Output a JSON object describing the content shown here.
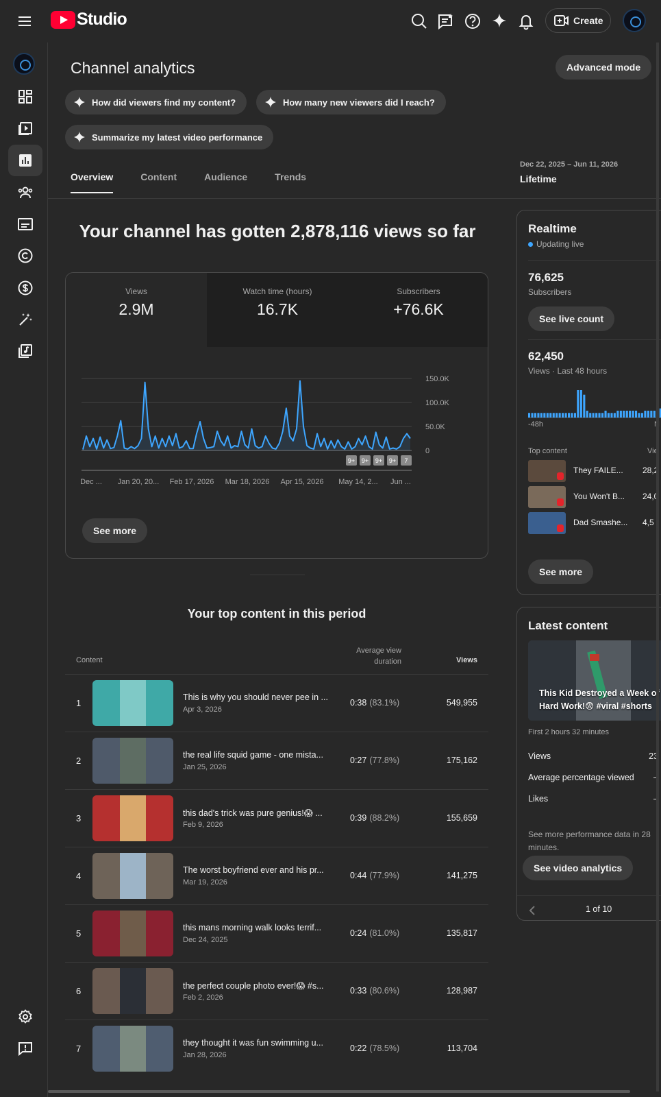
{
  "header": {
    "app_name": "Studio",
    "create_label": "Create"
  },
  "sidebar": {
    "items": [
      "dashboard-icon",
      "content-icon",
      "analytics-icon",
      "community-icon",
      "subtitles-icon",
      "copyright-icon",
      "earn-icon",
      "customization-icon",
      "audio-library-icon"
    ],
    "bottom": [
      "settings-icon",
      "feedback-icon"
    ]
  },
  "page": {
    "title": "Channel analytics",
    "advanced_mode_label": "Advanced mode",
    "chips": [
      "How did viewers find my content?",
      "How many new viewers did I reach?",
      "Summarize my latest video performance"
    ],
    "tabs": [
      "Overview",
      "Content",
      "Audience",
      "Trends"
    ],
    "active_tab": "Overview",
    "date_range": "Dec 22, 2025 – Jun 11, 2026",
    "date_label": "Lifetime",
    "headline": "Your channel has gotten 2,878,116 views so far"
  },
  "overview": {
    "metrics": [
      {
        "label": "Views",
        "value": "2.9M"
      },
      {
        "label": "Watch time (hours)",
        "value": "16.7K"
      },
      {
        "label": "Subscribers",
        "value": "+76.6K"
      }
    ],
    "see_more_label": "See more",
    "markers": [
      "9+",
      "9+",
      "9+",
      "9+",
      "7"
    ]
  },
  "chart_data": {
    "type": "line",
    "y_ticks": [
      "150.0K",
      "100.0K",
      "50.0K",
      "0"
    ],
    "ylim": [
      0,
      150000
    ],
    "x_tick_labels": [
      "Dec ...",
      "Jan 20, 20...",
      "Feb 17, 2026",
      "Mar 18, 2026",
      "Apr 15, 2026",
      "May 14, 2...",
      "Jun ..."
    ],
    "series": [
      {
        "color": "#3ea6ff",
        "values": [
          2000,
          30000,
          8000,
          25000,
          3000,
          28000,
          5000,
          22000,
          4000,
          6000,
          30000,
          62000,
          5000,
          3000,
          8000,
          4000,
          10000,
          25000,
          142000,
          45000,
          8000,
          30000,
          5000,
          25000,
          8000,
          30000,
          10000,
          35000,
          5000,
          8000,
          20000,
          4000,
          4000,
          35000,
          60000,
          25000,
          5000,
          6000,
          8000,
          40000,
          20000,
          10000,
          30000,
          5000,
          10000,
          8000,
          40000,
          12000,
          5000,
          45000,
          10000,
          5000,
          8000,
          30000,
          15000,
          5000,
          3000,
          15000,
          40000,
          88000,
          30000,
          20000,
          45000,
          145000,
          50000,
          10000,
          5000,
          3000,
          35000,
          8000,
          25000,
          3000,
          20000,
          5000,
          22000,
          8000,
          3000,
          18000,
          3000,
          8000,
          25000,
          12000,
          30000,
          8000,
          3000,
          38000,
          12000,
          5000,
          28000,
          3000,
          5000,
          3000,
          8000,
          25000,
          35000,
          25000
        ]
      }
    ]
  },
  "top_content": {
    "title": "Your top content in this period",
    "columns": {
      "content": "Content",
      "duration": "Average view duration",
      "views": "Views"
    },
    "rows": [
      {
        "rank": "1",
        "title": "This is why you should never pee in ...",
        "date": "Apr 3, 2026",
        "duration": "0:38",
        "percent": "(83.1%)",
        "views": "549,955",
        "bg": "#3fa9a7",
        "fg": "#7fc9c6"
      },
      {
        "rank": "2",
        "title": "the real life squid game - one mista...",
        "date": "Jan 25, 2026",
        "duration": "0:27",
        "percent": "(77.8%)",
        "views": "175,162",
        "bg": "#4f5a6a",
        "fg": "#5e6d63"
      },
      {
        "rank": "3",
        "title": "this dad's trick was pure genius!😱 ...",
        "date": "Feb 9, 2026",
        "duration": "0:39",
        "percent": "(88.2%)",
        "views": "155,659",
        "bg": "#b5302f",
        "fg": "#d9a86c"
      },
      {
        "rank": "4",
        "title": "The worst boyfriend ever and his pr...",
        "date": "Mar 19, 2026",
        "duration": "0:44",
        "percent": "(77.9%)",
        "views": "141,275",
        "bg": "#6e6358",
        "fg": "#9db4c7"
      },
      {
        "rank": "5",
        "title": "this mans morning walk looks terrif...",
        "date": "Dec 24, 2025",
        "duration": "0:24",
        "percent": "(81.0%)",
        "views": "135,817",
        "bg": "#8a2130",
        "fg": "#6f5c4a"
      },
      {
        "rank": "6",
        "title": "the perfect couple photo ever!😱 #s...",
        "date": "Feb 2, 2026",
        "duration": "0:33",
        "percent": "(80.6%)",
        "views": "128,987",
        "bg": "#6a5a50",
        "fg": "#2b2f36"
      },
      {
        "rank": "7",
        "title": "they thought it was fun swimming u...",
        "date": "Jan 28, 2026",
        "duration": "0:22",
        "percent": "(78.5%)",
        "views": "113,704",
        "bg": "#4f5d70",
        "fg": "#7b8a80"
      }
    ]
  },
  "realtime": {
    "title": "Realtime",
    "live_label": "Updating live",
    "subscribers_value": "76,625",
    "subscribers_label": "Subscribers",
    "see_live_count_label": "See live count",
    "views_value": "62,450",
    "views_label": "Views · Last 48 hours",
    "axis_left": "-48h",
    "axis_right": "N",
    "top_content_label": "Top content",
    "top_content_col": "Vie",
    "items": [
      {
        "title": "They FAILE...",
        "views": "28,2",
        "bg": "#5b4a3d"
      },
      {
        "title": "You Won't B...",
        "views": "24,0",
        "bg": "#7a6a5a"
      },
      {
        "title": "Dad Smashe...",
        "views": "4,5",
        "bg": "#3a5f8f"
      }
    ],
    "see_more_label": "See more",
    "spark": [
      2,
      2,
      2,
      2,
      2,
      2,
      2,
      2,
      2,
      2,
      2,
      2,
      2,
      2,
      2,
      2,
      12,
      12,
      10,
      3,
      2,
      2,
      2,
      2,
      2,
      3,
      2,
      2,
      2,
      3,
      3,
      3,
      3,
      3,
      3,
      3,
      2,
      2,
      3,
      3,
      3,
      3,
      4,
      4,
      4,
      4,
      4,
      3
    ]
  },
  "latest": {
    "title": "Latest content",
    "video_title": "This Kid Destroyed a Week of Hard Work!😨 #viral #shorts",
    "first_period": "First 2 hours 32 minutes",
    "rows": [
      {
        "label": "Views",
        "value": "23"
      },
      {
        "label": "Average percentage viewed",
        "value": "–"
      },
      {
        "label": "Likes",
        "value": "–"
      }
    ],
    "note": "See more performance data in 28 minutes.",
    "see_analytics_label": "See video analytics",
    "pager": "1 of 10"
  }
}
